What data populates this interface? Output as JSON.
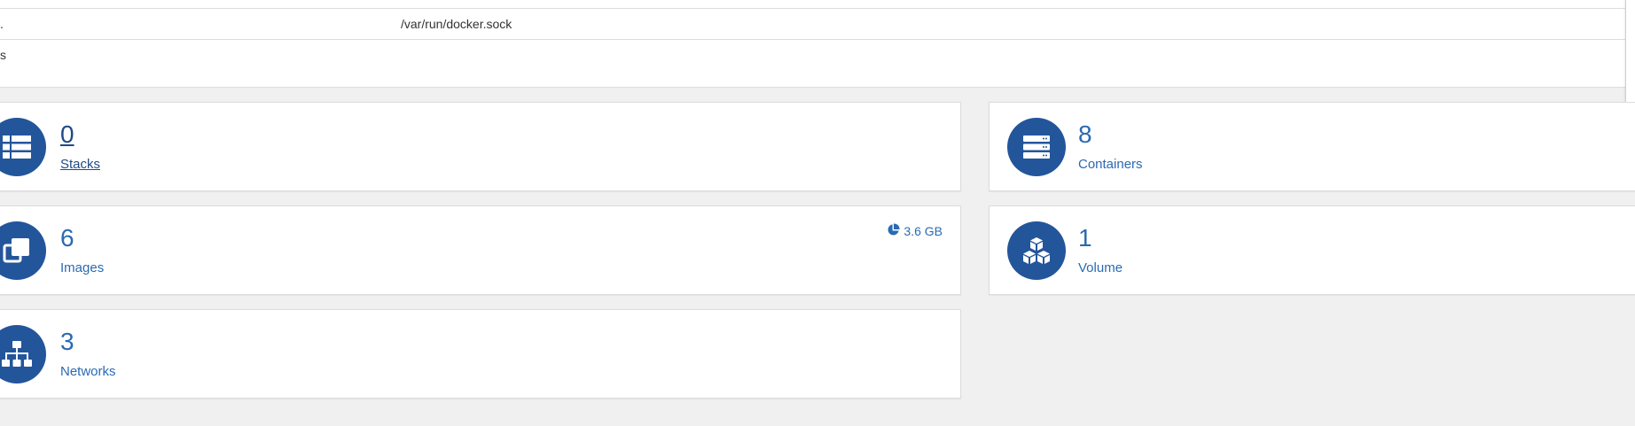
{
  "env_table": {
    "rows": [
      {
        "key": ".",
        "value": "/var/run/docker.sock"
      },
      {
        "key": "s",
        "value": ""
      }
    ]
  },
  "tiles": {
    "stacks": {
      "count": "0",
      "label": "Stacks",
      "icon": "list-icon"
    },
    "containers": {
      "count": "8",
      "label": "Containers",
      "icon": "server-icon"
    },
    "images": {
      "count": "6",
      "label": "Images",
      "icon": "clone-icon",
      "size": "3.6 GB",
      "size_icon": "pie-chart-icon"
    },
    "volume": {
      "count": "1",
      "label": "Volume",
      "icon": "cubes-icon"
    },
    "networks": {
      "count": "3",
      "label": "Networks",
      "icon": "sitemap-icon"
    }
  },
  "colors": {
    "icon_bg": "#23559b",
    "accent_text": "#2a6ab3",
    "page_bg": "#f0f0f0"
  }
}
